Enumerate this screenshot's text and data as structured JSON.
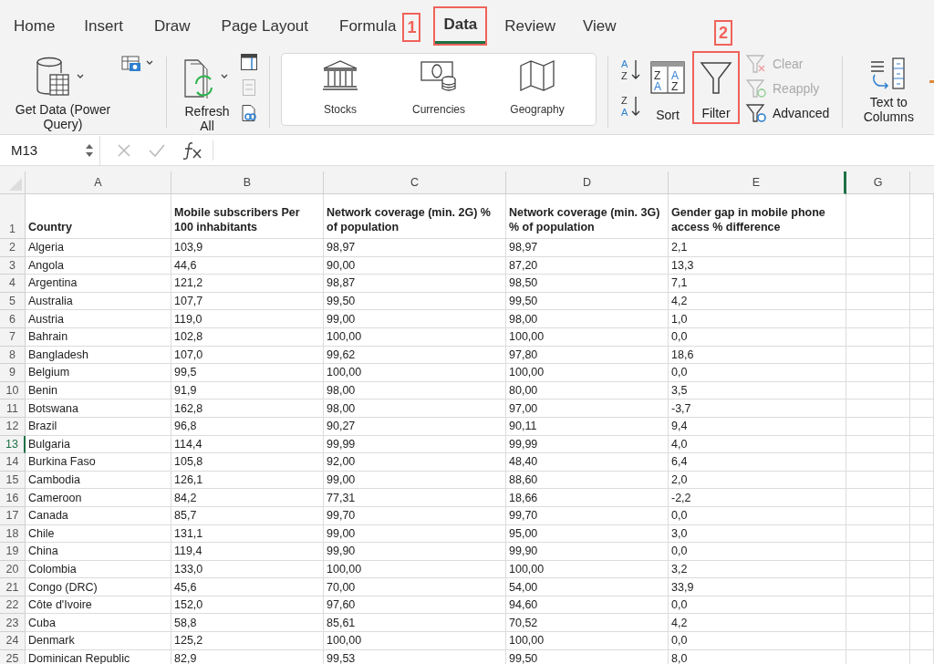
{
  "tabs": [
    {
      "label": "Home",
      "selected": false,
      "highlighted": false
    },
    {
      "label": "Insert",
      "selected": false,
      "highlighted": false
    },
    {
      "label": "Draw",
      "selected": false,
      "highlighted": false
    },
    {
      "label": "Page Layout",
      "selected": false,
      "highlighted": false
    },
    {
      "label": "Formula",
      "selected": false,
      "highlighted": false
    },
    {
      "label": "Data",
      "selected": true,
      "highlighted": true
    },
    {
      "label": "Review",
      "selected": false,
      "highlighted": false
    },
    {
      "label": "View",
      "selected": false,
      "highlighted": false
    }
  ],
  "annotations": [
    {
      "label": "1"
    },
    {
      "label": "2"
    }
  ],
  "ribbon": {
    "get_data": {
      "label": "Get Data (Power Query)"
    },
    "refresh_all": {
      "label": "Refresh All"
    },
    "data_types": [
      {
        "label": "Stocks"
      },
      {
        "label": "Currencies"
      },
      {
        "label": "Geography"
      }
    ],
    "sort_ascending": {
      "letters": [
        "A",
        "Z"
      ]
    },
    "sort_descending": {
      "letters": [
        "Z",
        "A"
      ]
    },
    "sort": {
      "label": "Sort",
      "letters": [
        "Z",
        "A",
        "A",
        "Z"
      ]
    },
    "filter": {
      "label": "Filter",
      "highlighted": true
    },
    "filter_options": [
      {
        "label": "Clear",
        "disabled": true
      },
      {
        "label": "Reapply",
        "disabled": true
      },
      {
        "label": "Advanced",
        "disabled": false
      }
    ],
    "text_to_columns": {
      "label": "Text to Columns"
    }
  },
  "formula_bar": {
    "name_box": "M13"
  },
  "sheet": {
    "columns": [
      {
        "label": "A"
      },
      {
        "label": "B"
      },
      {
        "label": "C"
      },
      {
        "label": "D"
      },
      {
        "label": "E"
      },
      {
        "label": "G"
      }
    ],
    "header_row": {
      "number": "1",
      "cells": [
        "Country",
        "Mobile subscribers Per 100 inhabitants",
        "Network coverage (min. 2G) % of population",
        "Network coverage (min. 3G) % of population",
        "Gender gap in mobile phone access % difference"
      ]
    },
    "rows": [
      {
        "number": "2",
        "selected": false,
        "cells": [
          "Algeria",
          "103,9",
          "98,97",
          "98,97",
          "2,1"
        ]
      },
      {
        "number": "3",
        "selected": false,
        "cells": [
          "Angola",
          "44,6",
          "90,00",
          "87,20",
          "13,3"
        ]
      },
      {
        "number": "4",
        "selected": false,
        "cells": [
          "Argentina",
          "121,2",
          "98,87",
          "98,50",
          "7,1"
        ]
      },
      {
        "number": "5",
        "selected": false,
        "cells": [
          "Australia",
          "107,7",
          "99,50",
          "99,50",
          "4,2"
        ]
      },
      {
        "number": "6",
        "selected": false,
        "cells": [
          "Austria",
          "119,0",
          "99,00",
          "98,00",
          "1,0"
        ]
      },
      {
        "number": "7",
        "selected": false,
        "cells": [
          "Bahrain",
          "102,8",
          "100,00",
          "100,00",
          "0,0"
        ]
      },
      {
        "number": "8",
        "selected": false,
        "cells": [
          "Bangladesh",
          "107,0",
          "99,62",
          "97,80",
          "18,6"
        ]
      },
      {
        "number": "9",
        "selected": false,
        "cells": [
          "Belgium",
          "99,5",
          "100,00",
          "100,00",
          "0,0"
        ]
      },
      {
        "number": "10",
        "selected": false,
        "cells": [
          "Benin",
          "91,9",
          "98,00",
          "80,00",
          "3,5"
        ]
      },
      {
        "number": "11",
        "selected": false,
        "cells": [
          "Botswana",
          "162,8",
          "98,00",
          "97,00",
          "-3,7"
        ]
      },
      {
        "number": "12",
        "selected": false,
        "cells": [
          "Brazil",
          "96,8",
          "90,27",
          "90,11",
          "9,4"
        ]
      },
      {
        "number": "13",
        "selected": true,
        "cells": [
          "Bulgaria",
          "114,4",
          "99,99",
          "99,99",
          "4,0"
        ]
      },
      {
        "number": "14",
        "selected": false,
        "cells": [
          "Burkina Faso",
          "105,8",
          "92,00",
          "48,40",
          "6,4"
        ]
      },
      {
        "number": "15",
        "selected": false,
        "cells": [
          "Cambodia",
          "126,1",
          "99,00",
          "88,60",
          "2,0"
        ]
      },
      {
        "number": "16",
        "selected": false,
        "cells": [
          "Cameroon",
          "84,2",
          "77,31",
          "18,66",
          "-2,2"
        ]
      },
      {
        "number": "17",
        "selected": false,
        "cells": [
          "Canada",
          "85,7",
          "99,70",
          "99,70",
          "0,0"
        ]
      },
      {
        "number": "18",
        "selected": false,
        "cells": [
          "Chile",
          "131,1",
          "99,00",
          "95,00",
          "3,0"
        ]
      },
      {
        "number": "19",
        "selected": false,
        "cells": [
          "China",
          "119,4",
          "99,90",
          "99,90",
          "0,0"
        ]
      },
      {
        "number": "20",
        "selected": false,
        "cells": [
          "Colombia",
          "133,0",
          "100,00",
          "100,00",
          "3,2"
        ]
      },
      {
        "number": "21",
        "selected": false,
        "cells": [
          "Congo (DRC)",
          "45,6",
          "70,00",
          "54,00",
          "33,9"
        ]
      },
      {
        "number": "22",
        "selected": false,
        "cells": [
          "Côte d'Ivoire",
          "152,0",
          "97,60",
          "94,60",
          "0,0"
        ]
      },
      {
        "number": "23",
        "selected": false,
        "cells": [
          "Cuba",
          "58,8",
          "85,61",
          "70,52",
          "4,2"
        ]
      },
      {
        "number": "24",
        "selected": false,
        "cells": [
          "Denmark",
          "125,2",
          "100,00",
          "100,00",
          "0,0"
        ]
      },
      {
        "number": "25",
        "selected": false,
        "cells": [
          "Dominican Republic",
          "82,9",
          "99,53",
          "99,50",
          "8,0"
        ]
      }
    ]
  }
}
